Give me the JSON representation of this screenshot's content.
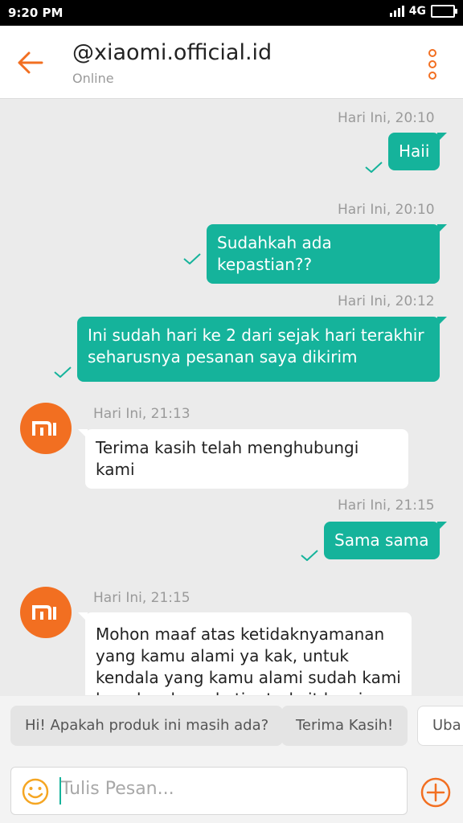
{
  "status": {
    "time": "9:20 PM",
    "network": "4G"
  },
  "header": {
    "title": "@xiaomi.official.id",
    "subtitle": "Online"
  },
  "avatar": {
    "logo_text": "mi"
  },
  "messages": [
    {
      "time": "Hari Ini, 20:10",
      "text": "Haii",
      "sender": "me"
    },
    {
      "time": "Hari Ini, 20:10",
      "text": "Sudahkah ada kepastian??",
      "sender": "me"
    },
    {
      "time": "Hari Ini, 20:12",
      "text": "Ini sudah hari ke 2 dari sejak hari terakhir seharusnya pesanan saya dikirim",
      "sender": "me"
    },
    {
      "time": "Hari Ini, 21:13",
      "text": "Terima kasih telah menghubungi kami",
      "sender": "shop"
    },
    {
      "time": "Hari Ini, 21:15",
      "text": "Sama sama",
      "sender": "me"
    },
    {
      "time": "Hari Ini, 21:15",
      "text": "Mohon maaf atas ketidaknyamanan yang kamu alami ya kak, untuk kendala yang kamu alami sudah kami laporkan kepada tim terkait kami ya",
      "sender": "shop"
    }
  ],
  "quick_replies": [
    "Hi! Apakah produk ini masih ada?",
    "Terima Kasih!",
    "Uba"
  ],
  "composer": {
    "placeholder": "Tulis Pesan..."
  },
  "colors": {
    "accent": "#15b39b",
    "brand": "#f26f21"
  }
}
